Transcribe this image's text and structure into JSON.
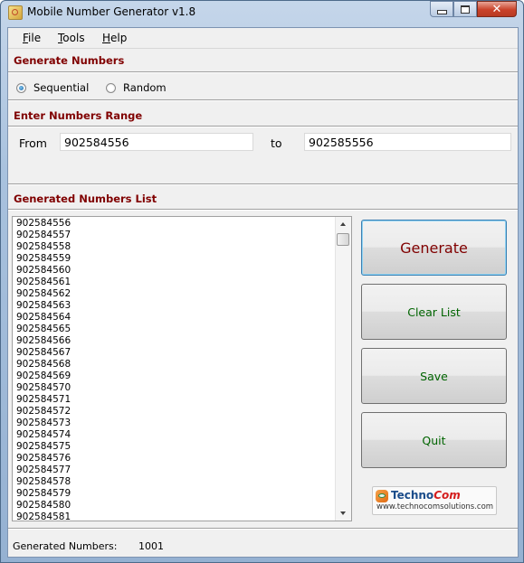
{
  "window": {
    "title": "Mobile Number Generator v1.8",
    "controls": {
      "minimize": "minimize",
      "maximize": "maximize",
      "close": "close"
    }
  },
  "menu": [
    {
      "label": "File",
      "accel": "F"
    },
    {
      "label": "Tools",
      "accel": "T"
    },
    {
      "label": "Help",
      "accel": "H"
    }
  ],
  "generate_section": {
    "heading": "Generate Numbers",
    "options": [
      {
        "label": "Sequential",
        "selected": true
      },
      {
        "label": "Random",
        "selected": false
      }
    ]
  },
  "range_section": {
    "heading": "Enter Numbers Range",
    "from_label": "From",
    "from_value": "902584556",
    "to_label": "to",
    "to_value": "902585556"
  },
  "list_section": {
    "heading": "Generated Numbers List",
    "items": [
      "902584556",
      "902584557",
      "902584558",
      "902584559",
      "902584560",
      "902584561",
      "902584562",
      "902584563",
      "902584564",
      "902584565",
      "902584566",
      "902584567",
      "902584568",
      "902584569",
      "902584570",
      "902584571",
      "902584572",
      "902584573",
      "902584574",
      "902584575",
      "902584576",
      "902584577",
      "902584578",
      "902584579",
      "902584580",
      "902584581"
    ]
  },
  "buttons": {
    "generate": "Generate",
    "clear": "Clear List",
    "save": "Save",
    "quit": "Quit"
  },
  "logo": {
    "name_part1": "Techno",
    "name_part2": "Com",
    "url": "www.technocomsolutions.com"
  },
  "status": {
    "label": "Generated Numbers:",
    "value": "1001"
  },
  "colors": {
    "heading": "#800000",
    "button_text": "#006400",
    "primary_button_text": "#800000"
  }
}
